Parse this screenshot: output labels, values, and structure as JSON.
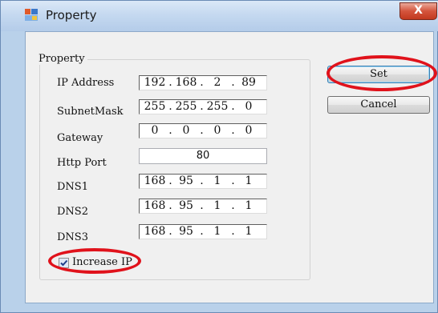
{
  "window": {
    "title": "Property",
    "close_glyph": "X"
  },
  "group": {
    "legend": "Property"
  },
  "fields": {
    "ip_address": {
      "label": "IP Address",
      "octets": [
        "192",
        "168",
        "2",
        "89"
      ]
    },
    "subnet_mask": {
      "label": "SubnetMask",
      "octets": [
        "255",
        "255",
        "255",
        "0"
      ]
    },
    "gateway": {
      "label": "Gateway",
      "octets": [
        "0",
        "0",
        "0",
        "0"
      ]
    },
    "http_port": {
      "label": "Http Port",
      "value": "80"
    },
    "dns1": {
      "label": "DNS1",
      "octets": [
        "168",
        "95",
        "1",
        "1"
      ]
    },
    "dns2": {
      "label": "DNS2",
      "octets": [
        "168",
        "95",
        "1",
        "1"
      ]
    },
    "dns3": {
      "label": "DNS3",
      "octets": [
        "168",
        "95",
        "1",
        "1"
      ]
    }
  },
  "increase_ip": {
    "label": "Increase IP",
    "checked": true
  },
  "buttons": {
    "set": "Set",
    "cancel": "Cancel"
  },
  "colors": {
    "annotation": "#e0121b",
    "titlebar": "#c5d9f0",
    "close": "#c2391e"
  },
  "icons": {
    "app": "window-app-icon",
    "close": "close-icon",
    "check": "check-icon"
  }
}
